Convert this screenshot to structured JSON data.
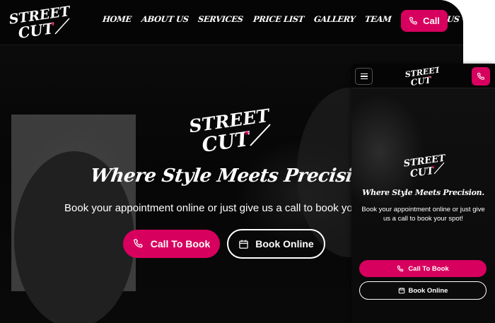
{
  "brand": {
    "logo_line1": "STREET",
    "logo_line2": "CUT",
    "accent": "#d8005e"
  },
  "nav": {
    "items": [
      "HOME",
      "ABOUT US",
      "SERVICES",
      "PRICE LIST",
      "GALLERY",
      "TEAM",
      "CONTACT US"
    ],
    "call_label": "Call",
    "call_icon": "phone-icon"
  },
  "hero": {
    "title": "Where Style Meets Precision",
    "subtitle": "Book your appointment online or just give us a call to book your spot!",
    "call_button": "Call To Book",
    "book_button": "Book Online",
    "book_icon": "calendar-icon"
  },
  "mobile": {
    "menu_icon": "hamburger-menu-icon",
    "title": "Where Style Meets Precision.",
    "subtitle": "Book your appointment online or just give us a call to book your spot!",
    "call_button": "Call To Book",
    "book_button": "Book Online"
  }
}
